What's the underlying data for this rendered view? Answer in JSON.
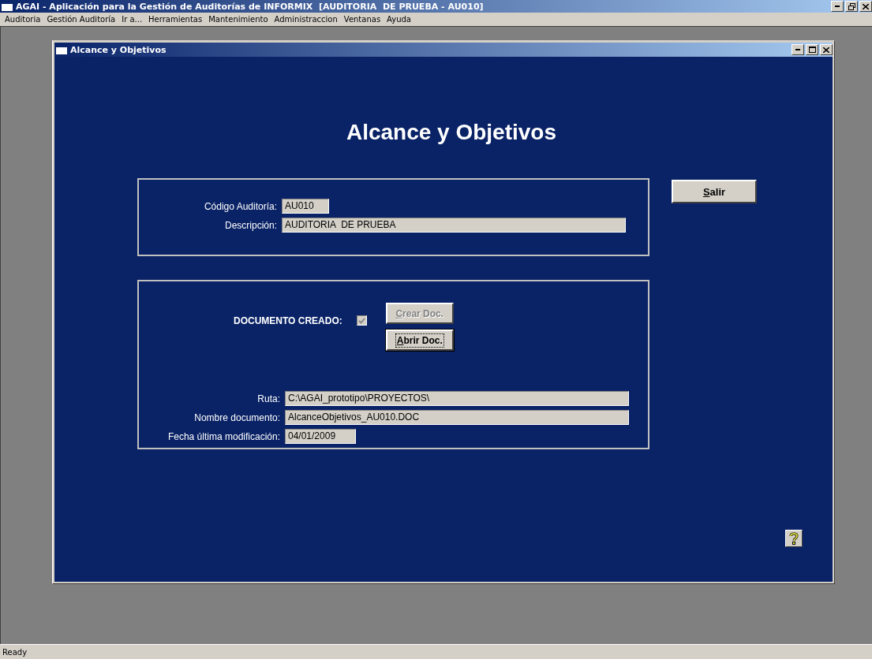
{
  "window": {
    "title": "AGAI - Aplicación para la Gestión de Auditorías de INFORMIX  [AUDITORIA  DE PRUEBA - AU010]"
  },
  "menu": [
    "Auditoria",
    "Gestión Auditoría",
    "Ir a...",
    "Herramientas",
    "Mantenimiento",
    "Administraccion",
    "Ventanas",
    "Ayuda"
  ],
  "child_window": {
    "title": "Alcance y Objetivos"
  },
  "form": {
    "heading": "Alcance y Objetivos",
    "audit_fields": [
      {
        "label": "Código Auditoría:",
        "value": "AU010"
      },
      {
        "label": "Descripción:",
        "value": "AUDITORIA  DE PRUEBA"
      }
    ],
    "exit_button": {
      "label": "Salir",
      "disabled": false,
      "focused": false
    },
    "document_created": {
      "label": "DOCUMENTO CREADO:",
      "checked": true,
      "disabled": true
    },
    "doc_buttons": [
      {
        "label": "Crear Doc.",
        "disabled": true,
        "focused": false
      },
      {
        "label": "Abrir Doc.",
        "disabled": false,
        "focused": true
      }
    ],
    "doc_fields": [
      {
        "label": "Ruta:",
        "value": "C:\\AGAI_prototipo\\PROYECTOS\\"
      },
      {
        "label": "Nombre documento:",
        "value": "AlcanceObjetivos_AU010.DOC"
      },
      {
        "label": "Fecha última modificación:",
        "value": "04/01/2009"
      }
    ]
  },
  "status_bar": {
    "text": "Ready"
  }
}
